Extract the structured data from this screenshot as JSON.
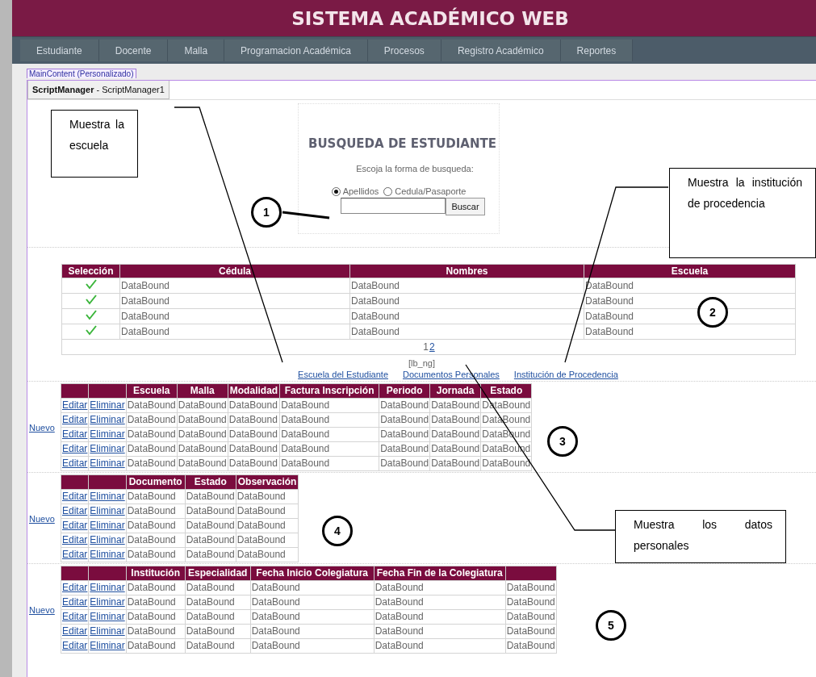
{
  "header": {
    "title": "SISTEMA ACADÉMICO WEB"
  },
  "menu": [
    {
      "label": "Estudiante"
    },
    {
      "label": "Docente"
    },
    {
      "label": "Malla"
    },
    {
      "label": "Programacion Académica"
    },
    {
      "label": "Procesos"
    },
    {
      "label": "Registro Académico"
    },
    {
      "label": "Reportes"
    }
  ],
  "content_tag": "MainContent (Personalizado)",
  "script_manager": "**ScriptManager** - ScriptManager1",
  "search": {
    "title": "BUSQUEDA DE ESTUDIANTE",
    "prompt": "Escoja la forma de busqueda:",
    "options": [
      {
        "label": "Apellidos",
        "selected": true
      },
      {
        "label": "Cedula/Pasaporte",
        "selected": false
      }
    ],
    "button": "Buscar"
  },
  "students_grid": {
    "select_column": "Selección",
    "columns": [
      "Cédula",
      "Nombres",
      "Escuela"
    ],
    "rows": [
      {
        "cells": [
          "DataBound",
          "DataBound",
          "DataBound"
        ]
      },
      {
        "cells": [
          "DataBound",
          "DataBound",
          "DataBound"
        ]
      },
      {
        "cells": [
          "DataBound",
          "DataBound",
          "DataBound"
        ]
      },
      {
        "cells": [
          "DataBound",
          "DataBound",
          "DataBound"
        ]
      }
    ],
    "pager": [
      {
        "label": "1",
        "selected": true
      },
      {
        "label": "2",
        "selected": false
      }
    ]
  },
  "status_label": "[lb_ng]",
  "links": [
    "Escuela del Estudiante",
    "Documentos Personales",
    "Institución de Procedencia"
  ],
  "grids": [
    {
      "new_link": "Nuevo",
      "columns": [
        "Escuela",
        "Malla",
        "Modalidad",
        "Factura Inscripción",
        "Periodo",
        "Jornada",
        "Estado"
      ],
      "rows": [
        {
          "edit": "Editar",
          "delete": "Eliminar",
          "cells": [
            "DataBound",
            "DataBound",
            "DataBound",
            "DataBound",
            "DataBound",
            "DataBound",
            "DataBound"
          ]
        },
        {
          "edit": "Editar",
          "delete": "Eliminar",
          "cells": [
            "DataBound",
            "DataBound",
            "DataBound",
            "DataBound",
            "DataBound",
            "DataBound",
            "DataBound"
          ]
        },
        {
          "edit": "Editar",
          "delete": "Eliminar",
          "cells": [
            "DataBound",
            "DataBound",
            "DataBound",
            "DataBound",
            "DataBound",
            "DataBound",
            "DataBound"
          ]
        },
        {
          "edit": "Editar",
          "delete": "Eliminar",
          "cells": [
            "DataBound",
            "DataBound",
            "DataBound",
            "DataBound",
            "DataBound",
            "DataBound",
            "DataBound"
          ]
        },
        {
          "edit": "Editar",
          "delete": "Eliminar",
          "cells": [
            "DataBound",
            "DataBound",
            "DataBound",
            "DataBound",
            "DataBound",
            "DataBound",
            "DataBound"
          ]
        }
      ]
    },
    {
      "new_link": "Nuevo",
      "columns": [
        "Documento",
        "Estado",
        "Observación"
      ],
      "rows": [
        {
          "edit": "Editar",
          "delete": "Eliminar",
          "cells": [
            "DataBound",
            "DataBound",
            "DataBound"
          ]
        },
        {
          "edit": "Editar",
          "delete": "Eliminar",
          "cells": [
            "DataBound",
            "DataBound",
            "DataBound"
          ]
        },
        {
          "edit": "Editar",
          "delete": "Eliminar",
          "cells": [
            "DataBound",
            "DataBound",
            "DataBound"
          ]
        },
        {
          "edit": "Editar",
          "delete": "Eliminar",
          "cells": [
            "DataBound",
            "DataBound",
            "DataBound"
          ]
        },
        {
          "edit": "Editar",
          "delete": "Eliminar",
          "cells": [
            "DataBound",
            "DataBound",
            "DataBound"
          ]
        }
      ]
    },
    {
      "new_link": "Nuevo",
      "columns": [
        "Institución",
        "Especialidad",
        "Fecha Inicio Colegiatura",
        "Fecha Fin de la Colegiatura"
      ],
      "rows": [
        {
          "edit": "Editar",
          "delete": "Eliminar",
          "cells": [
            "DataBound",
            "DataBound",
            "DataBound",
            "DataBound",
            "DataBound"
          ]
        },
        {
          "edit": "Editar",
          "delete": "Eliminar",
          "cells": [
            "DataBound",
            "DataBound",
            "DataBound",
            "DataBound",
            "DataBound"
          ]
        },
        {
          "edit": "Editar",
          "delete": "Eliminar",
          "cells": [
            "DataBound",
            "DataBound",
            "DataBound",
            "DataBound",
            "DataBound"
          ]
        },
        {
          "edit": "Editar",
          "delete": "Eliminar",
          "cells": [
            "DataBound",
            "DataBound",
            "DataBound",
            "DataBound",
            "DataBound"
          ]
        },
        {
          "edit": "Editar",
          "delete": "Eliminar",
          "cells": [
            "DataBound",
            "DataBound",
            "DataBound",
            "DataBound",
            "DataBound"
          ]
        }
      ]
    }
  ],
  "callouts": [
    {
      "text": "Muestra la escuela"
    },
    {
      "text": "Muestra la institución de procedencia"
    },
    {
      "text": "Muestra los datos personales"
    }
  ],
  "markers": [
    "1",
    "2",
    "3",
    "4",
    "5"
  ]
}
